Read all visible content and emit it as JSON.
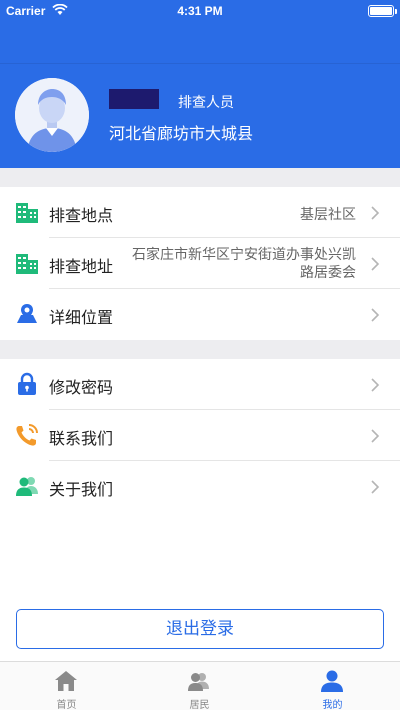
{
  "status_bar": {
    "carrier": "Carrier",
    "time": "4:31 PM"
  },
  "profile": {
    "role": "排查人员",
    "region": "河北省廊坊市大城县"
  },
  "menu_group_1": [
    {
      "label": "排查地点",
      "value": "基层社区",
      "icon": "building-icon"
    },
    {
      "label": "排查地址",
      "value": "石家庄市新华区宁安街道办事处兴凯路居委会",
      "icon": "building-icon"
    },
    {
      "label": "详细位置",
      "value": "",
      "icon": "map-pin-icon"
    }
  ],
  "menu_group_2": [
    {
      "label": "修改密码",
      "icon": "lock-icon"
    },
    {
      "label": "联系我们",
      "icon": "phone-icon"
    },
    {
      "label": "关于我们",
      "icon": "users-icon"
    }
  ],
  "logout_label": "退出登录",
  "tabs": [
    {
      "label": "首页",
      "icon": "home-icon"
    },
    {
      "label": "居民",
      "icon": "residents-icon"
    },
    {
      "label": "我的",
      "icon": "person-icon",
      "active": true
    }
  ],
  "colors": {
    "primary": "#2a6ce6",
    "green": "#1fba7a",
    "orange": "#f39a2b"
  }
}
